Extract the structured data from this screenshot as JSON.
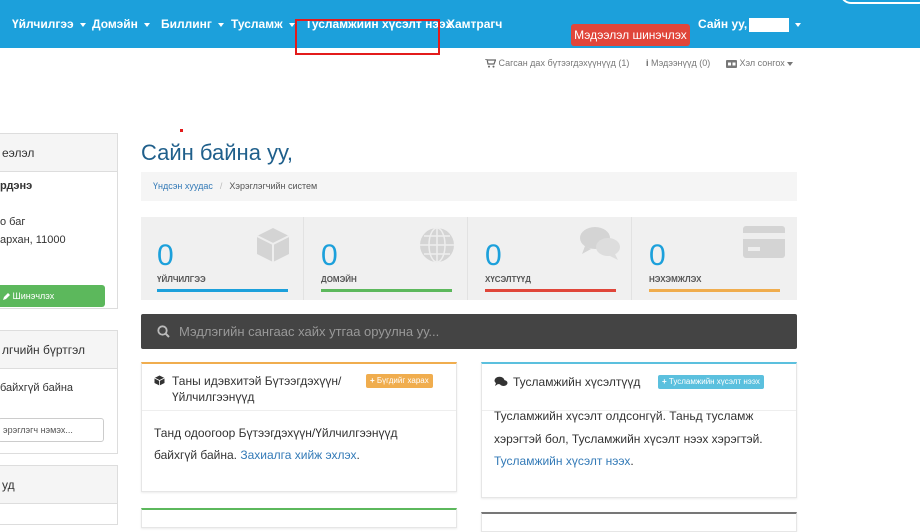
{
  "nav": {
    "services": "Үйлчилгээ",
    "domains": "Домэйн",
    "billing": "Биллинг",
    "support": "Тусламж",
    "open_ticket": "Тусламжийн хүсэлт нээх",
    "affiliates": "Хамтрагч",
    "update_info": "Мэдээлэл шинэчлэх",
    "greeting": "Сайн уу,"
  },
  "utility": {
    "cart": "Сагсан дах бүтээгдэхүүнүүд (1)",
    "notifications": "Мэдээнүүд (0)",
    "language": "Хэл сонгох"
  },
  "sidebar": {
    "info_title": "еэлэл",
    "name": "рдэнэ",
    "addr1": "о баг",
    "addr2": "архан, 11000",
    "update_btn": "Шинэчлэх",
    "contacts_title": "лгчийн бүртгэл",
    "no_contacts": "байхгүй байна",
    "new_contact": "эрэглэгч нэмэх...",
    "shortcuts_title": "уд"
  },
  "main": {
    "title": "Сайн байна уу,",
    "breadcrumb": {
      "home": "Үндсэн хуудас",
      "current": "Хэрэглэгчийн систем"
    },
    "stats": [
      {
        "value": "0",
        "label": "ҮЙЛЧИЛГЭЭ",
        "color": "#1ca0db",
        "icon": "cube-icon"
      },
      {
        "value": "0",
        "label": "ДОМЭЙН",
        "color": "#5cb85c",
        "icon": "globe-icon"
      },
      {
        "value": "0",
        "label": "ХҮСЭЛТҮҮД",
        "color": "#e0463a",
        "icon": "comments-icon"
      },
      {
        "value": "0",
        "label": "НЭХЭМЖЛЭХ",
        "color": "#f0ad4e",
        "icon": "credit-card-icon"
      }
    ],
    "search_placeholder": "Мэдлэгийн сангаас хайх утгаа оруулна уу..."
  },
  "panels": {
    "products": {
      "title_line1": "Таны идэвхитэй Бүтээгдэхүүн/",
      "title_line2": "Үйлчилгээнүүд",
      "badge": "Бүгдийг харах",
      "body_line1": "Танд одоогоор Бүтээгдэхүүн/Үйлчилгээнүүд",
      "body_text2": "байхгүй байна.",
      "body_link": "Захиалга хийж эхлэх",
      "body_end": "."
    },
    "tickets": {
      "title": "Тусламжийн хүсэлтүүд",
      "badge": "Тусламжийн хүсэлт нээх",
      "body_line1": "Тусламжийн хүсэлт олдсонгүй. Таньд тусламж",
      "body_line2": "хэрэгтэй бол, Тусламжийн хүсэлт нээх хэрэгтэй.",
      "body_link": "Тусламжийн хүсэлт нээх",
      "body_end": "."
    }
  },
  "colors": {
    "primary": "#1ca0db",
    "danger": "#e0463a",
    "success": "#5cb85c",
    "warning": "#f0ad4e",
    "info": "#5bc0de"
  }
}
